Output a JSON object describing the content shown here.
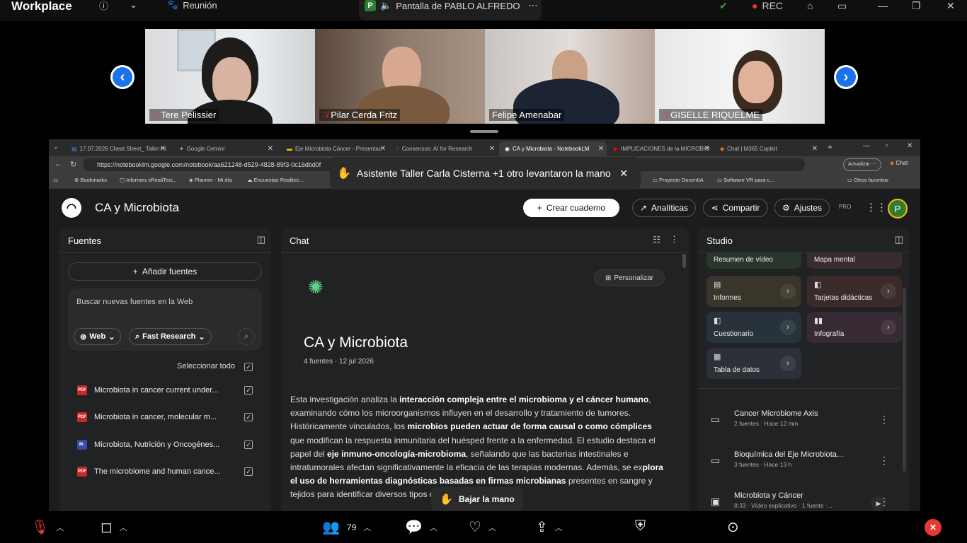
{
  "zoom": {
    "app_name": "Workplace",
    "meeting_label": "Reunión",
    "share_badge": "P",
    "share_label": "Pantalla de PABLO ALFREDO",
    "rec_label": "REC"
  },
  "participants": [
    {
      "name": "Tere Pelissier"
    },
    {
      "name": "Pilar Cerda Fritz"
    },
    {
      "name": "Felipe Amenabar"
    },
    {
      "name": "GISELLE RIQUELME"
    }
  ],
  "browser": {
    "tabs": [
      {
        "label": "17.07.2026 Cheat Sheet_ Taller Hi"
      },
      {
        "label": "Google Gemini"
      },
      {
        "label": "Eje Microbiota Cáncer - Presentac"
      },
      {
        "label": "Consensus: AI for Research"
      },
      {
        "label": "CA y Microbiota - NotebookLM"
      },
      {
        "label": "IMPLICACIONES de la MICROBIO"
      },
      {
        "label": "Chat | M365 Copilot"
      }
    ],
    "url": "https://notebooklm.google.com/notebook/aa621248-d529-4828-89f3-0c16dbd0f",
    "update_label": "Actualizar",
    "chat_label": "Chat",
    "bookmarks": [
      {
        "label": "Bookmarks"
      },
      {
        "label": "Informes xRealiTeci..."
      },
      {
        "label": "Planner - Mi día"
      },
      {
        "label": "Encuestas Realitec..."
      },
      {
        "label": "Proyecto DocentIA"
      },
      {
        "label": "Software VR para c..."
      },
      {
        "label": "Otros favoritos"
      }
    ]
  },
  "raise_toast": {
    "text": "Asistente Taller Carla Cisterna +1 otro levantaron la mano"
  },
  "notebook": {
    "title": "CA y Microbiota",
    "create_label": "Crear cuaderno",
    "analytics_label": "Analíticas",
    "share_label": "Compartir",
    "settings_label": "Ajustes",
    "pro_label": "PRO",
    "avatar_letter": "P"
  },
  "sources": {
    "title": "Fuentes",
    "add_label": "Añadir fuentes",
    "search_placeholder": "Buscar nuevas fuentes en la Web",
    "web_label": "Web",
    "research_label": "Fast Research",
    "select_all": "Seleccionar todo",
    "items": [
      {
        "label": "Microbiota in cancer current under...",
        "type": "PDF"
      },
      {
        "label": "Microbiota in cancer, molecular m...",
        "type": "PDF"
      },
      {
        "label": "Microbiota, Nutrición y Oncogénes...",
        "type": "M↓"
      },
      {
        "label": "The microbiome and human cance...",
        "type": "PDF"
      }
    ]
  },
  "chat": {
    "title": "Chat",
    "personalize_label": "Personalizar",
    "heading": "CA y Microbiota",
    "meta": "4 fuentes · 12 jul 2026",
    "summary": [
      {
        "t": "Esta investigación analiza la ",
        "b": false
      },
      {
        "t": "interacción compleja entre el microbioma y el cáncer humano",
        "b": true
      },
      {
        "t": ", examinando cómo los microorganismos influyen en el desarrollo y tratamiento de tumores. Históricamente vinculados, los ",
        "b": false
      },
      {
        "t": "microbios pueden actuar de forma causal o como cómplices",
        "b": true
      },
      {
        "t": " que modifican la respuesta inmunitaria del huésped frente a la enfermedad. El estudio destaca el papel del ",
        "b": false
      },
      {
        "t": "eje inmuno-oncología-microbioma",
        "b": true
      },
      {
        "t": ", señalando que las bacterias intestinales e intratumorales afectan significativamente la eficacia de las terapias modernas. Además, se ex",
        "b": false
      },
      {
        "t": "plora el uso de herramientas diagnósticas basadas en firmas microbianas",
        "b": true
      },
      {
        "t": " presentes en ",
        "b": false
      },
      {
        "t": "sangre y tejidos p",
        "b": false
      },
      {
        "t": "ara identificar diversos tipos de",
        "b": false
      }
    ]
  },
  "studio": {
    "title": "Studio",
    "cards": [
      {
        "label": "Resumen de vídeo",
        "color": "#28362b"
      },
      {
        "label": "Mapa mental",
        "color": "#3a2a31"
      },
      {
        "label": "Informes",
        "color": "#39352a"
      },
      {
        "label": "Tarjetas didácticas",
        "color": "#3a2a2a"
      },
      {
        "label": "Cuestionario",
        "color": "#28323a"
      },
      {
        "label": "Infografía",
        "color": "#382a35"
      },
      {
        "label": "Tabla de datos",
        "color": "#2c3038"
      }
    ],
    "notes": [
      {
        "title": "Cancer Microbiome Axis",
        "sub": "2 fuentes · Hace 12 min"
      },
      {
        "title": "Bioquímica del Eje Microbiota...",
        "sub": "3 fuentes · Hace 13 h"
      },
      {
        "title": "Microbiota y Cáncer",
        "sub": "8:33 · Vídeo explicativo · 1 fuente ·..."
      }
    ]
  },
  "lower_hand_label": "Bajar la mano",
  "toolbar": {
    "participants_count": "79"
  }
}
